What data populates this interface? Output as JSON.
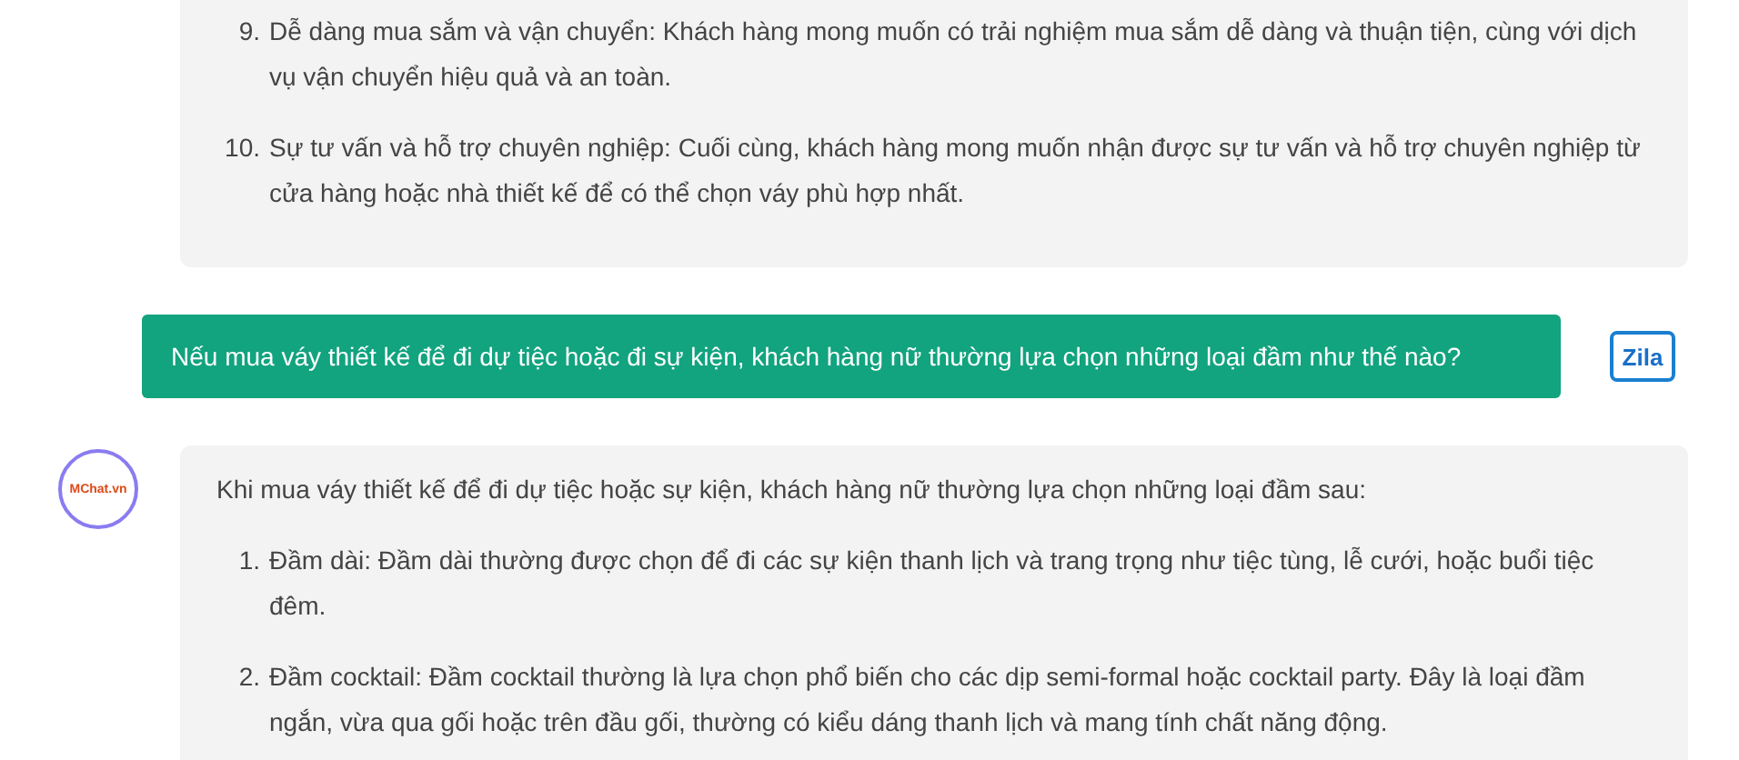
{
  "previous_answer": {
    "items": [
      {
        "number": "9.",
        "text": "Dễ dàng mua sắm và vận chuyển: Khách hàng mong muốn có trải nghiệm mua sắm dễ dàng và thuận tiện, cùng với dịch vụ vận chuyển hiệu quả và an toàn."
      },
      {
        "number": "10.",
        "text": "Sự tư vấn và hỗ trợ chuyên nghiệp: Cuối cùng, khách hàng mong muốn nhận được sự tư vấn và hỗ trợ chuyên nghiệp từ cửa hàng hoặc nhà thiết kế để có thể chọn váy phù hợp nhất."
      }
    ]
  },
  "question": {
    "avatar_text": "Zila",
    "text": "Nếu mua váy thiết kế để đi dự tiệc hoặc đi sự kiện, khách hàng nữ thường lựa chọn những loại đầm như thế nào?"
  },
  "answer": {
    "avatar_text": "MChat.vn",
    "intro": "Khi mua váy thiết kế để đi dự tiệc hoặc sự kiện, khách hàng nữ thường lựa chọn những loại đầm sau:",
    "items": [
      {
        "number": "1.",
        "text": "Đầm dài: Đầm dài thường được chọn để đi các sự kiện thanh lịch và trang trọng như tiệc tùng, lễ cưới, hoặc buổi tiệc đêm."
      },
      {
        "number": "2.",
        "text": "Đầm cocktail: Đầm cocktail thường là lựa chọn phổ biến cho các dịp semi-formal hoặc cocktail party. Đây là loại đầm ngắn, vừa qua gối hoặc trên đầu gối, thường có kiểu dáng thanh lịch và mang tính chất năng động."
      }
    ]
  }
}
